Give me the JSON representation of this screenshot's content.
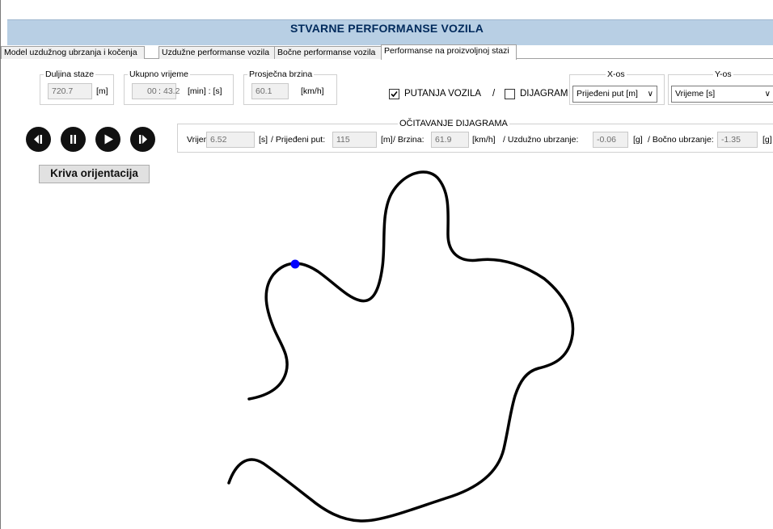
{
  "window": {
    "title": "STVARNE PERFORMANSE VOZILA"
  },
  "tabs": [
    {
      "label": "Model uzdužnog ubrzanja i kočenja"
    },
    {
      "label": "Uzdužne performanse vozila"
    },
    {
      "label": "Bočne performanse vozila"
    },
    {
      "label": "Performanse na proizvoljnoj stazi"
    }
  ],
  "summary": {
    "track_length": {
      "label": "Duljina staze",
      "value": "720.7",
      "unit": "[m]"
    },
    "total_time": {
      "label": "Ukupno vrijeme",
      "minutes": "00",
      "separator": ":",
      "seconds": "43.2",
      "unit": "[min] : [s]"
    },
    "avg_speed": {
      "label": "Prosječna  brzina",
      "value": "60.1",
      "unit": "[km/h]"
    }
  },
  "view_options": {
    "path_label": "PUTANJA VOZILA",
    "path_checked": true,
    "separator": "/",
    "diagram_label": "DIJAGRAM",
    "diagram_checked": false
  },
  "axes": {
    "x_label": "X-os",
    "x_value": "Prijeđeni put [m]",
    "y_label": "Y-os",
    "y_value": "Vrijeme [s]"
  },
  "readout": {
    "title": "OČITAVANJE DIJAGRAMA",
    "time_label": "Vrijeme:",
    "time_value": "6.52",
    "time_unit": "[s]",
    "distance_label": "/ Prijeđeni put:",
    "distance_value": "115",
    "distance_unit": "[m]",
    "speed_label": "/  Brzina:",
    "speed_value": "61.9",
    "speed_unit": "[km/h]",
    "long_acc_label": "/  Uzdužno ubrzanje:",
    "long_acc_value": "-0.06",
    "long_acc_unit": "[g]",
    "lat_acc_label": "/ Bočno ubrzanje:",
    "lat_acc_value": "-1.35",
    "lat_acc_unit": "[g]"
  },
  "controls": {
    "curve_orientation_button": "Kriva orijentacija",
    "icons": [
      "step-back-icon",
      "pause-icon",
      "play-icon",
      "step-forward-icon"
    ]
  },
  "colors": {
    "title_bar": "#b8cfe4",
    "title_text": "#002a5c",
    "track": "#000000",
    "vehicle_marker": "#0000ff"
  }
}
